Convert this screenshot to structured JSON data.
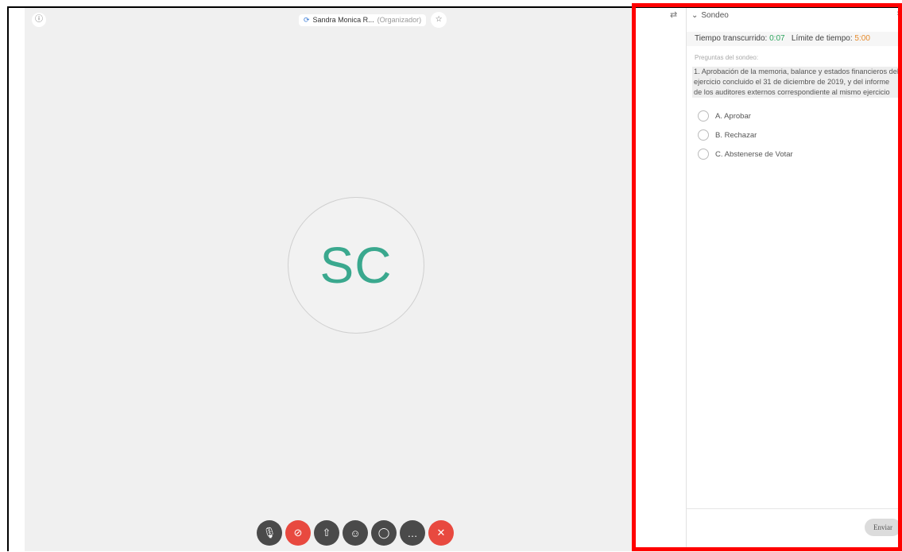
{
  "meeting": {
    "info_icon": "info-icon",
    "host_name": "Sandra Monica R...",
    "host_role": "(Organizador)",
    "avatar_initials": "SC"
  },
  "toolbar": {
    "buttons": [
      {
        "name": "mute",
        "icon": "microphone-icon",
        "glyph": "✐"
      },
      {
        "name": "video",
        "icon": "video-off-icon",
        "glyph": "⊘"
      },
      {
        "name": "share",
        "icon": "share-icon",
        "glyph": "⇧"
      },
      {
        "name": "participants",
        "icon": "participants-icon",
        "glyph": "☺"
      },
      {
        "name": "chat",
        "icon": "chat-icon",
        "glyph": "◯"
      },
      {
        "name": "more",
        "icon": "more-icon",
        "glyph": "…"
      },
      {
        "name": "leave",
        "icon": "close-icon",
        "glyph": "✕"
      }
    ]
  },
  "poll": {
    "title": "Sondeo",
    "time_elapsed_label": "Tiempo transcurrido:",
    "time_elapsed_value": "0:07",
    "time_limit_label": "Límite de tiempo:",
    "time_limit_value": "5:00",
    "questions_label": "Preguntas del sondeo:",
    "question": "1. Aprobación de la memoria, balance y estados financieros del ejercicio concluido el 31 de diciembre de 2019, y del informe de los auditores externos correspondiente al mismo ejercicio",
    "options": [
      "A. Aprobar",
      "B. Rechazar",
      "C. Abstenerse de Votar"
    ],
    "submit_label": "Enviar"
  },
  "colors": {
    "highlight_border": "#ff0000",
    "avatar_text": "#3aa88e",
    "elapsed": "#2ca45d",
    "limit": "#e58a2b",
    "leave_button": "#e8493f"
  }
}
